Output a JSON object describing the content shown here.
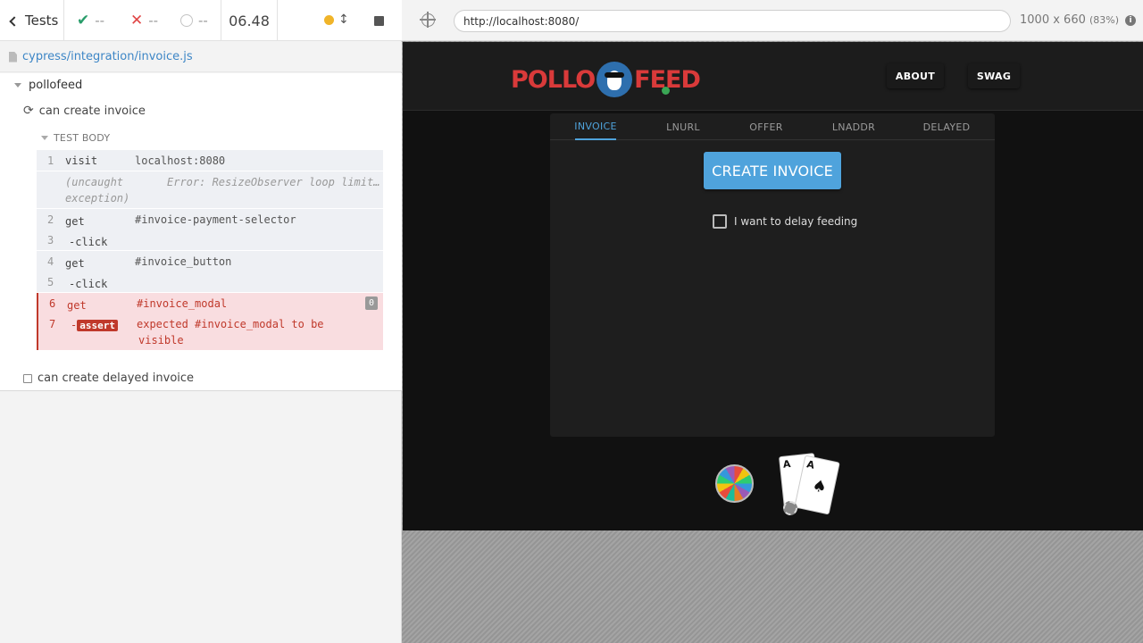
{
  "reporter": {
    "tests_label": "Tests",
    "passed": "--",
    "failed": "--",
    "pending": "--",
    "duration": "06.48",
    "spec_path": "cypress/integration/invoice.js",
    "suite_title": "pollofeed",
    "test_running": "can create invoice",
    "test_body_label": "TEST BODY",
    "commands": [
      {
        "num": "1",
        "name": "visit",
        "message": "localhost:8080"
      },
      {
        "num": "",
        "name": "(uncaught exception)",
        "name_line1": "(uncaught",
        "name_line2": "exception)",
        "message": "Error: ResizeObserver loop limit…"
      },
      {
        "num": "2",
        "name": "get",
        "message": "#invoice-payment-selector"
      },
      {
        "num": "3",
        "name": "-click",
        "message": ""
      },
      {
        "num": "4",
        "name": "get",
        "message": "#invoice_button"
      },
      {
        "num": "5",
        "name": "-click",
        "message": ""
      },
      {
        "num": "6",
        "name": "get",
        "message": "#invoice_modal",
        "badge": "0"
      },
      {
        "num": "7",
        "name": "-assert",
        "dash": "-",
        "tag": "assert",
        "message_line1": "expected #invoice_modal to be",
        "message_line2": "visible"
      }
    ],
    "test_pending": "can create delayed invoice"
  },
  "aut": {
    "url": "http://localhost:8080/",
    "viewport": "1000 x 660",
    "zoom": "(83%)",
    "app": {
      "logo_left": "POLLO",
      "logo_right": "FEED",
      "nav": [
        "ABOUT",
        "SWAG"
      ],
      "tabs": [
        "INVOICE",
        "LNURL",
        "OFFER",
        "LNADDR",
        "DELAYED"
      ],
      "active_tab": "INVOICE",
      "create_button": "CREATE INVOICE",
      "delay_checkbox_label": "I want to delay feeding",
      "card_rank": "A"
    }
  },
  "colors": {
    "accent": "#4fa3dc",
    "fail": "#c0392b",
    "pass": "#2a9d6b",
    "running": "#f0b429"
  }
}
